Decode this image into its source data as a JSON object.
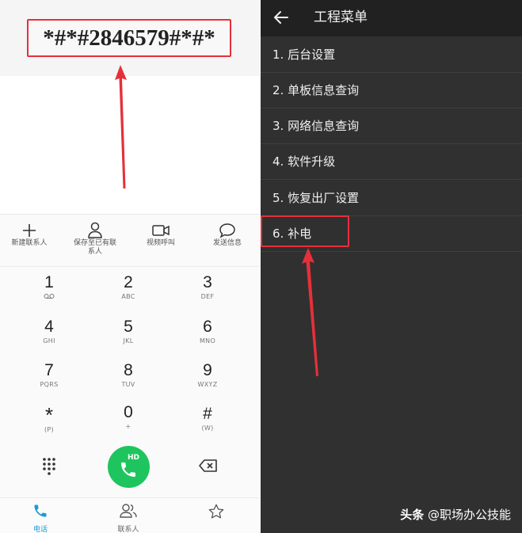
{
  "dialer": {
    "number": "*#*#2846579#*#*",
    "actions": [
      {
        "label": "新建联系人",
        "icon": "add-icon"
      },
      {
        "label": "保存至已有联系人",
        "icon": "person-icon"
      },
      {
        "label": "视频呼叫",
        "icon": "video-call-icon"
      },
      {
        "label": "发送信息",
        "icon": "message-icon"
      }
    ],
    "keys": [
      {
        "num": "1",
        "sub": "ꝏ"
      },
      {
        "num": "2",
        "sub": "ABC"
      },
      {
        "num": "3",
        "sub": "DEF"
      },
      {
        "num": "4",
        "sub": "GHI"
      },
      {
        "num": "5",
        "sub": "JKL"
      },
      {
        "num": "6",
        "sub": "MNO"
      },
      {
        "num": "7",
        "sub": "PQRS"
      },
      {
        "num": "8",
        "sub": "TUV"
      },
      {
        "num": "9",
        "sub": "WXYZ"
      },
      {
        "num": "*",
        "sub": "(P)"
      },
      {
        "num": "0",
        "sub": "+"
      },
      {
        "num": "#",
        "sub": "(W)"
      }
    ],
    "call_badge": "HD",
    "call_color": "#1ec55e",
    "nav": [
      {
        "label": "电话",
        "icon": "phone-icon",
        "active": true
      },
      {
        "label": "联系人",
        "icon": "contacts-icon",
        "active": false
      },
      {
        "label": "",
        "icon": "star-icon",
        "active": false
      }
    ]
  },
  "engineering_menu": {
    "title": "工程菜单",
    "items": [
      "1. 后台设置",
      "2. 单板信息查询",
      "3. 网络信息查询",
      "4. 软件升级",
      "5. 恢复出厂设置",
      "6. 补电"
    ]
  },
  "watermark": {
    "brand": "头条",
    "handle": "@职场办公技能"
  },
  "colors": {
    "highlight": "#e5303a",
    "active_nav": "#1a9bd7",
    "menu_bg": "#303030"
  }
}
